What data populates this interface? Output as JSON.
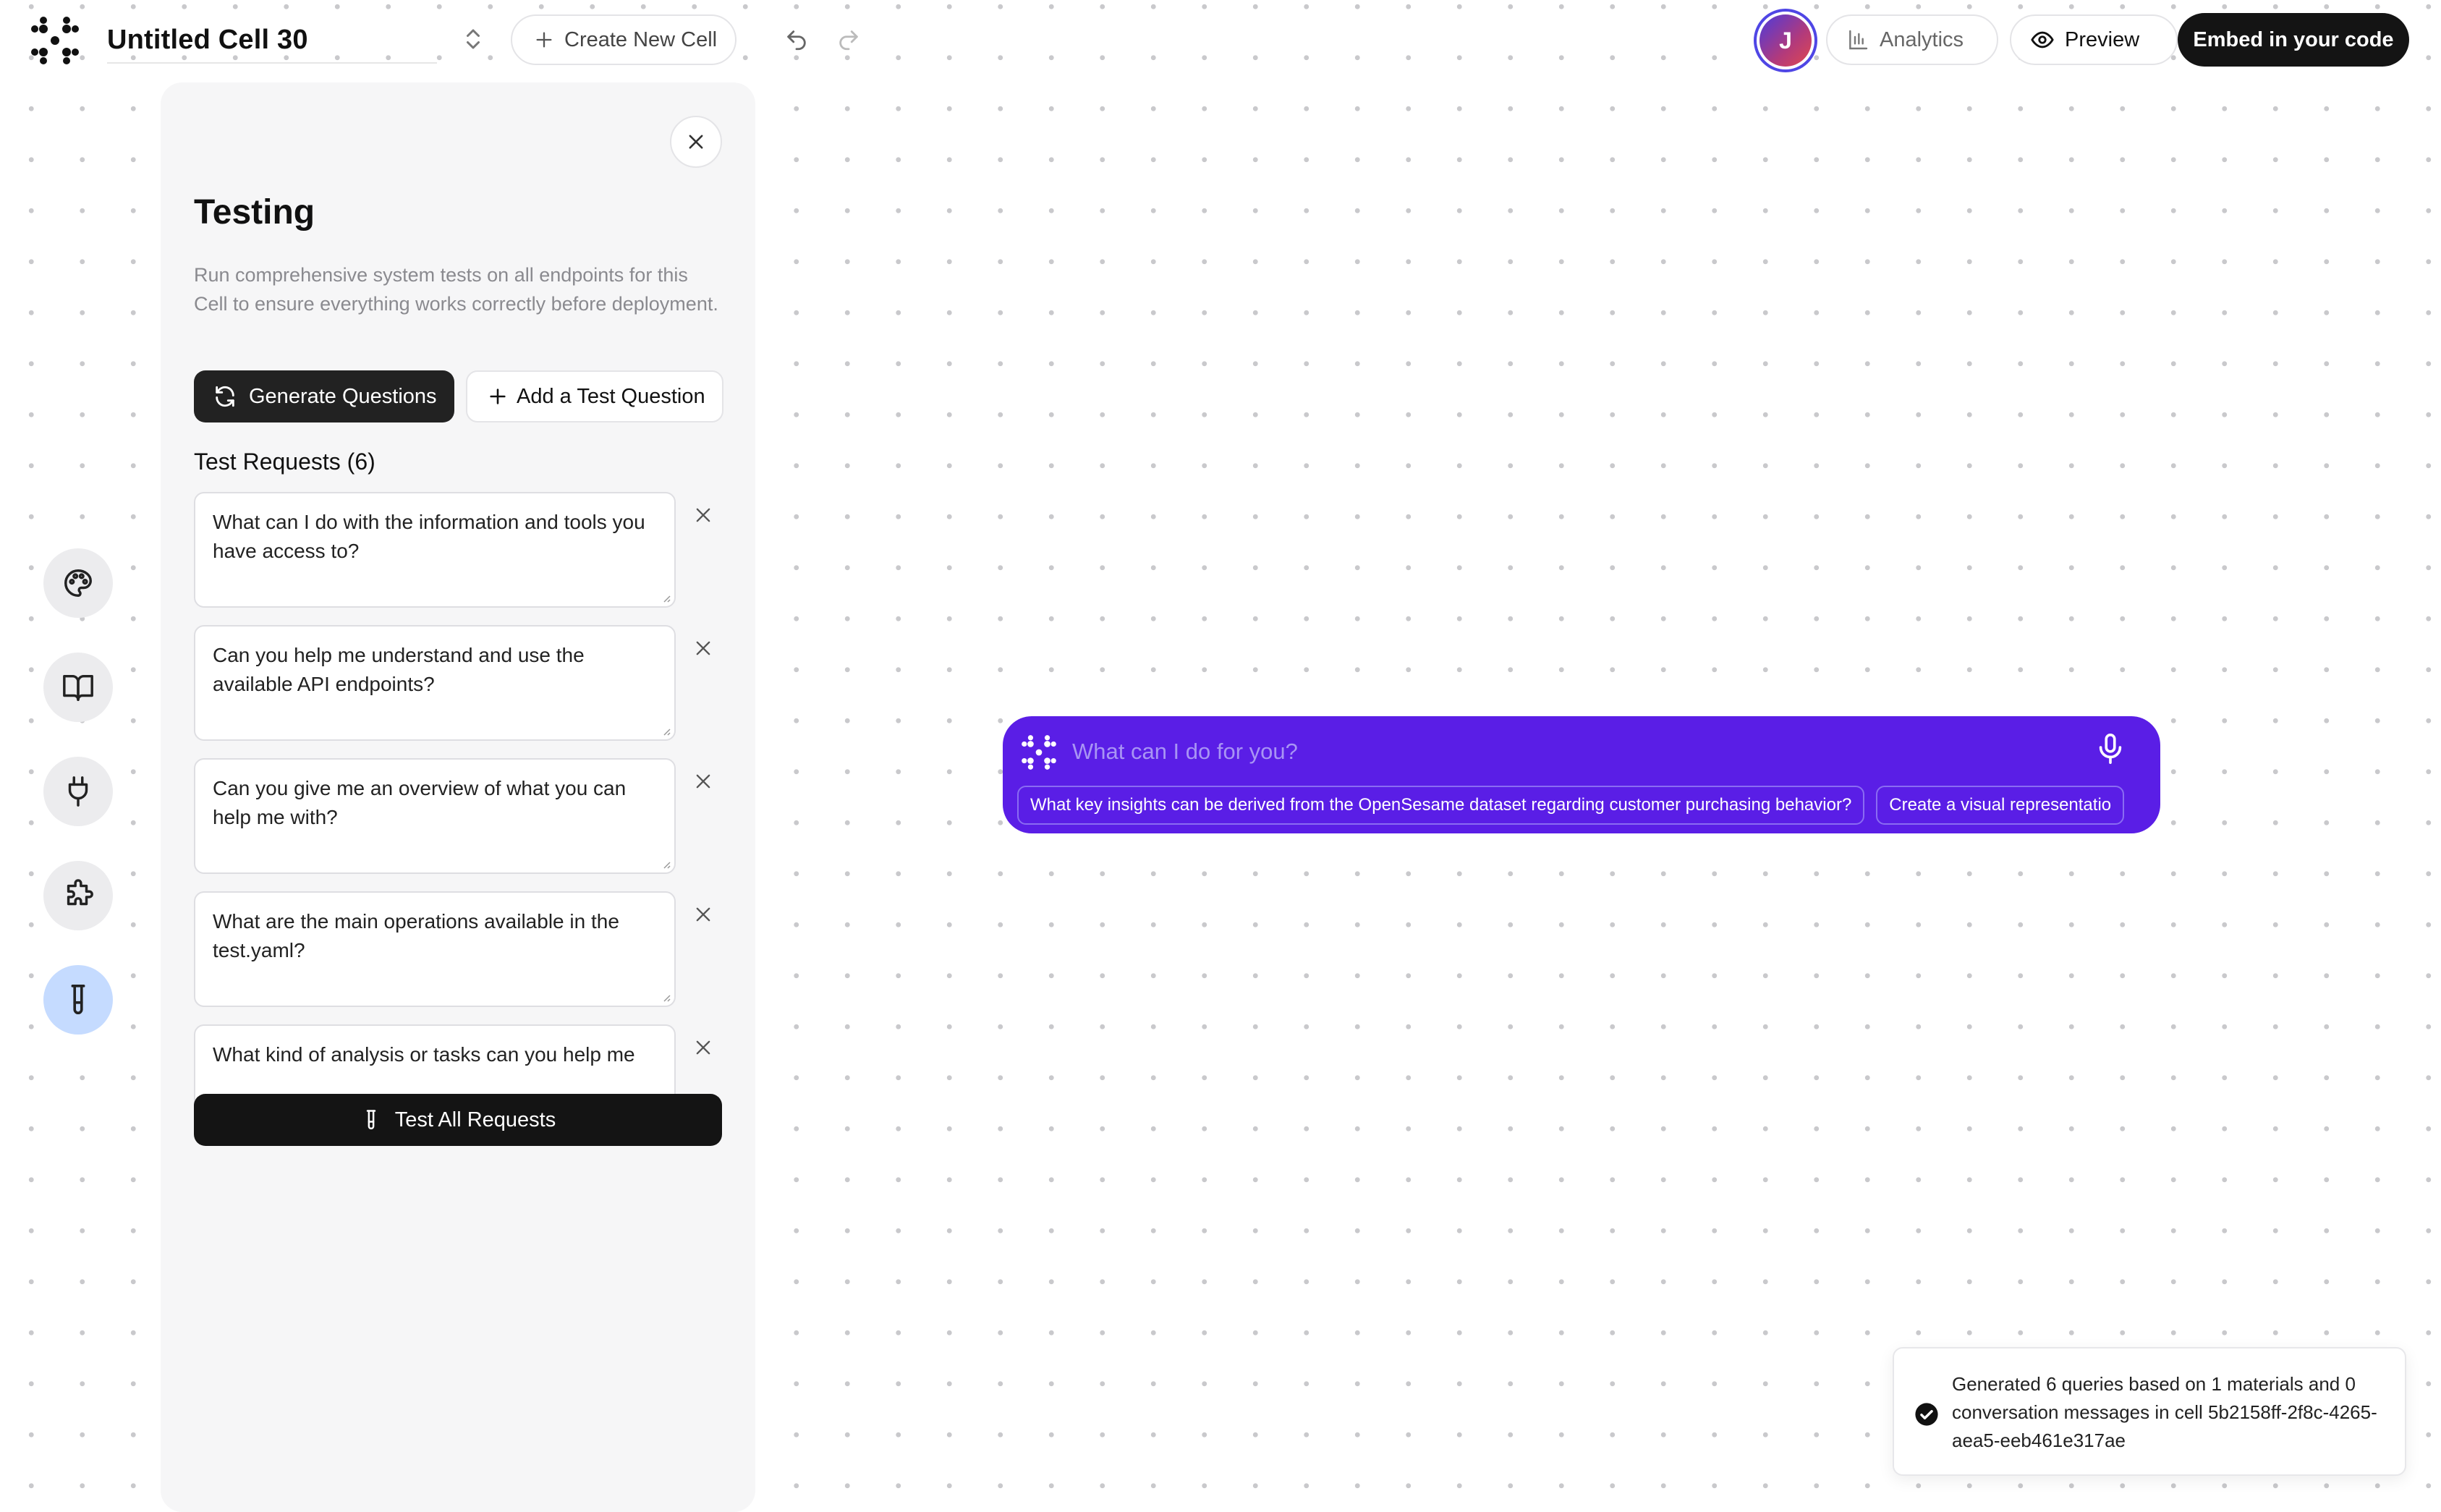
{
  "header": {
    "cell_title": "Untitled Cell 30",
    "create_label": "Create New Cell",
    "avatar_initial": "J",
    "analytics_label": "Analytics",
    "preview_label": "Preview",
    "embed_label": "Embed in your code"
  },
  "rail": {
    "items": [
      "palette-icon",
      "book-open-icon",
      "plug-icon",
      "puzzle-icon",
      "test-tube-icon"
    ],
    "active": "test-tube-icon"
  },
  "panel": {
    "title": "Testing",
    "description": "Run comprehensive system tests on all endpoints for this Cell to ensure everything works correctly before deployment.",
    "generate_label": "Generate Questions",
    "add_label": "Add a Test Question",
    "requests_title": "Test Requests (6)",
    "requests": [
      "What can I do with the information and tools you have access to?",
      "Can you help me understand and use the available API endpoints?",
      "Can you give me an overview of what you can help me with?",
      "What are the main operations available in the test.yaml?",
      "What kind of analysis or tasks can you help me"
    ],
    "test_all_label": "Test All Requests"
  },
  "chat": {
    "placeholder": "What can I do for you?",
    "suggestions": [
      "What key insights can be derived from the OpenSesame dataset regarding customer purchasing behavior?",
      "Create a visual representatio"
    ]
  },
  "toast": {
    "message": "Generated 6 queries based on 1 materials and 0 conversation messages in cell 5b2158ff-2f8c-4265-aea5-eeb461e317ae"
  },
  "colors": {
    "chat_bg": "#5a1ee6",
    "primary_dark": "#141414",
    "active_rail": "#c5dbff",
    "avatar_ring": "#4f46e5"
  }
}
